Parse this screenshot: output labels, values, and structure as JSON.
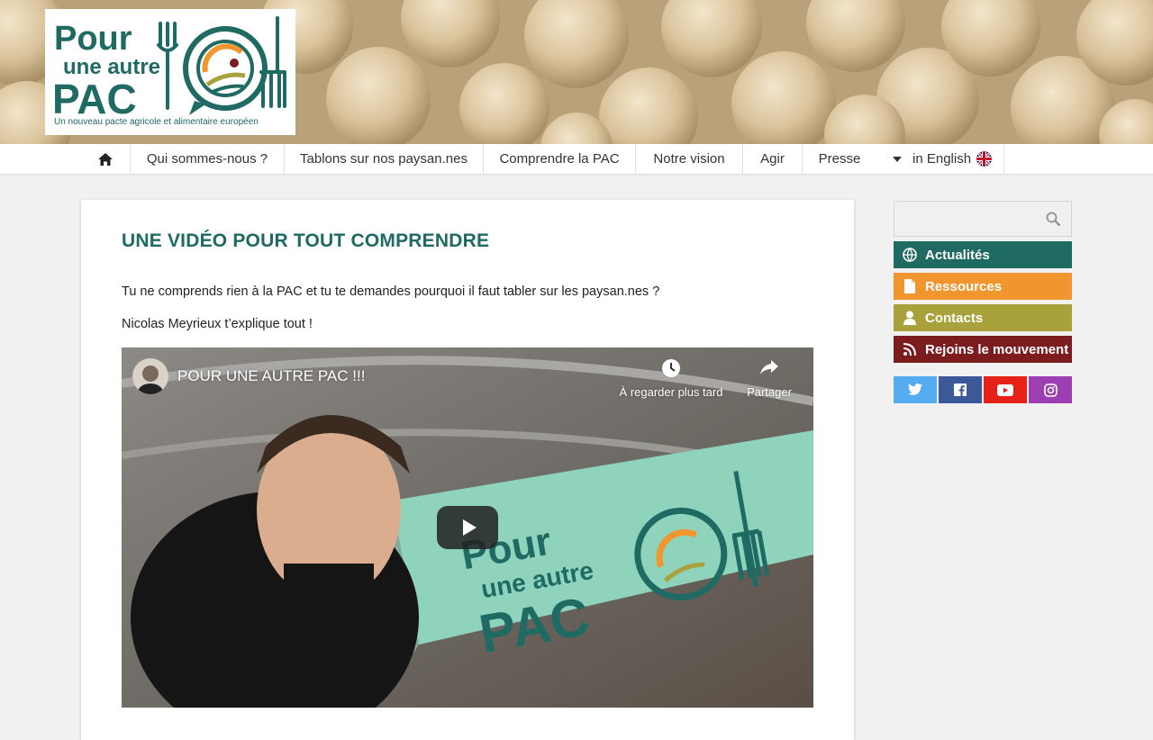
{
  "logo": {
    "line1": "Pour",
    "line2": "une autre",
    "line3": "PAC",
    "tagline": "Un nouveau pacte agricole et alimentaire européen"
  },
  "nav": {
    "items": [
      {
        "label": "Qui sommes-nous ?"
      },
      {
        "label": "Tablons sur nos paysan.nes"
      },
      {
        "label": "Comprendre la PAC"
      },
      {
        "label": "Notre vision"
      },
      {
        "label": "Agir"
      },
      {
        "label": "Presse"
      }
    ],
    "language": "in English",
    "home_icon": "home-icon"
  },
  "post": {
    "title": "UNE VIDÉO POUR TOUT COMPRENDRE",
    "paragraphs": [
      "Tu ne comprends rien à la PAC et tu te demandes pourquoi il faut tabler sur les paysan.nes ?",
      "Nicolas Meyrieux t’explique tout !"
    ]
  },
  "video": {
    "title": "POUR UNE AUTRE PAC !!!",
    "watch_later": "À regarder plus tard",
    "share": "Partager"
  },
  "sidebar": {
    "search_placeholder": "",
    "buttons": [
      {
        "label": "Actualités",
        "icon": "globe-icon",
        "color": "#1f6a62"
      },
      {
        "label": "Ressources",
        "icon": "document-icon",
        "color": "#f1962e"
      },
      {
        "label": "Contacts",
        "icon": "person-icon",
        "color": "#a9a23c"
      },
      {
        "label": "Rejoins le mouvement",
        "icon": "rss-icon",
        "color": "#7c1c1f"
      }
    ],
    "social": [
      {
        "name": "twitter-icon",
        "color": "#55acee"
      },
      {
        "name": "facebook-icon",
        "color": "#3b5998"
      },
      {
        "name": "youtube-icon",
        "color": "#e62117"
      },
      {
        "name": "instagram-icon",
        "color": "#9b3fb2"
      }
    ]
  },
  "colors": {
    "brand_teal": "#1f6a62",
    "brand_orange": "#f1962e",
    "brand_olive": "#a9a23c",
    "brand_maroon": "#7c1c1f"
  }
}
